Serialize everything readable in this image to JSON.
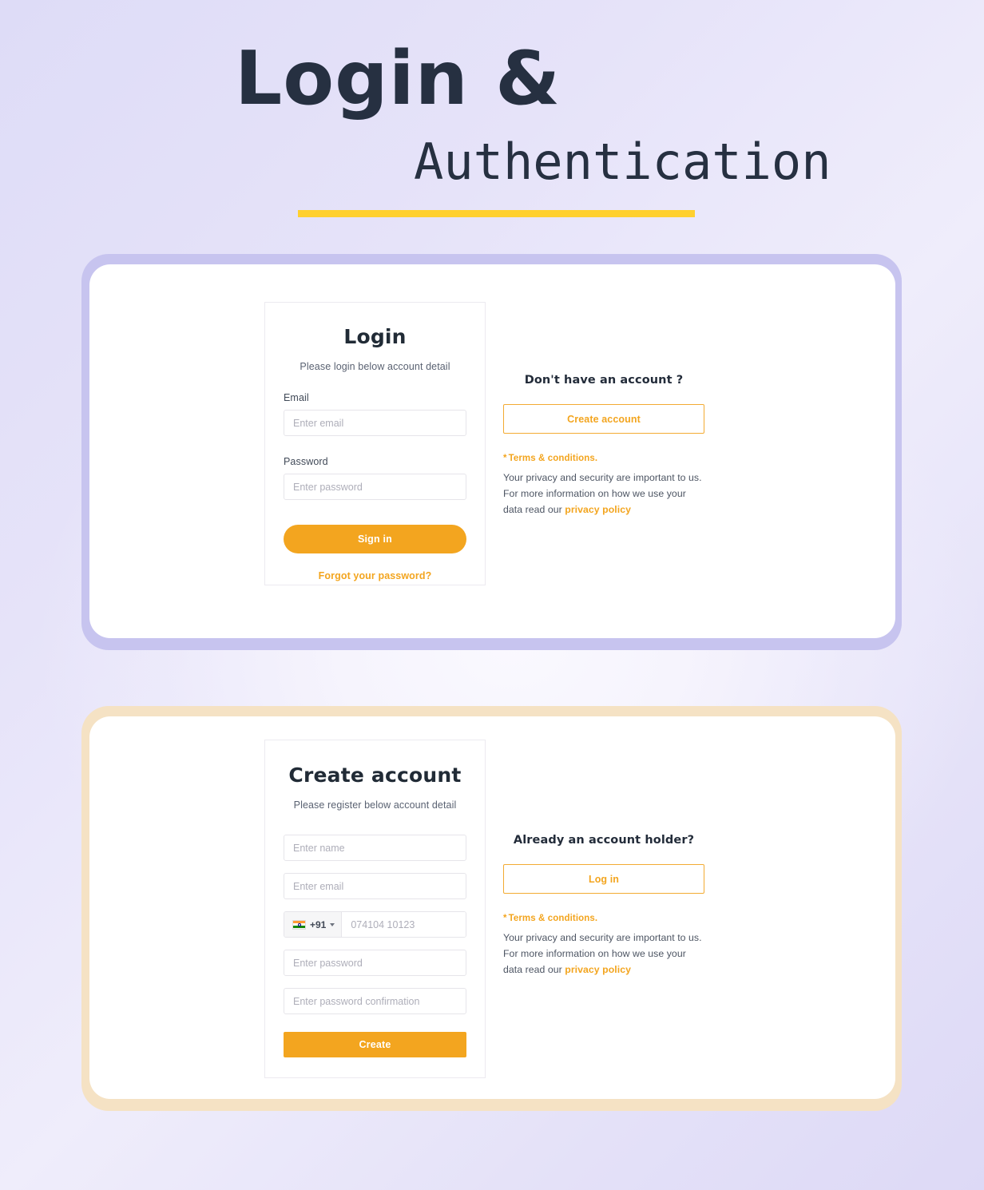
{
  "page": {
    "heading_line1": "Login &",
    "heading_line2": "Authentication",
    "accent_yellow": "#ffd02e",
    "accent_orange": "#f3a51f",
    "frame_purple": "#c7c4ef",
    "frame_tan": "#f5e2c4",
    "text_dark": "#263041"
  },
  "login_section": {
    "card": {
      "title": "Login",
      "subtitle": "Please login below account detail",
      "email_label": "Email",
      "email_placeholder": "Enter email",
      "email_value": "",
      "password_label": "Password",
      "password_placeholder": "Enter password",
      "password_value": "",
      "submit_label": "Sign in",
      "forgot_label": "Forgot your password?"
    },
    "side": {
      "heading": "Don't have an account ?",
      "button_label": "Create account",
      "terms_asterisk": "*",
      "terms_label": "Terms & conditions.",
      "privacy_text_1": "Your privacy and security are important to us.",
      "privacy_text_2": "For more information on how we use your",
      "privacy_text_3": "data read our ",
      "privacy_link": "privacy policy"
    }
  },
  "register_section": {
    "card": {
      "title": "Create account",
      "subtitle": "Please register below account detail",
      "name_placeholder": "Enter name",
      "name_value": "",
      "email_placeholder": "Enter email",
      "email_value": "",
      "country_code": "+91",
      "country_flag": "india-flag-icon",
      "phone_placeholder": "074104 10123",
      "phone_value": "",
      "password_placeholder": "Enter password",
      "password_value": "",
      "password_confirm_placeholder": "Enter password confirmation",
      "password_confirm_value": "",
      "submit_label": "Create"
    },
    "side": {
      "heading": "Already an account holder?",
      "button_label": "Log in",
      "terms_asterisk": "*",
      "terms_label": "Terms & conditions.",
      "privacy_text_1": "Your privacy and security are important to us.",
      "privacy_text_2": "For more information on how we use your",
      "privacy_text_3": "data read our ",
      "privacy_link": "privacy policy"
    }
  }
}
